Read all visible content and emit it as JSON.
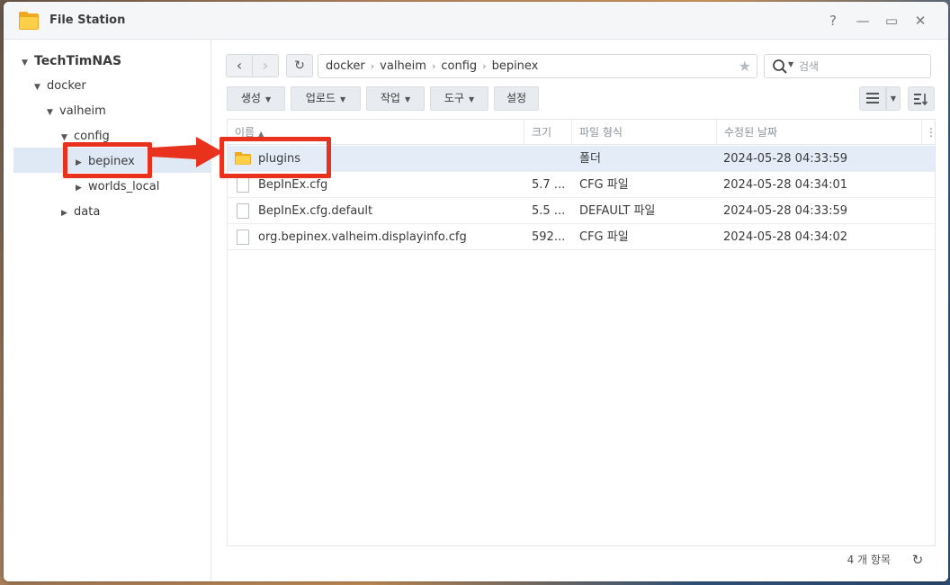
{
  "window": {
    "title": "File Station",
    "controls": {
      "help": "?",
      "minimize": "—",
      "maximize": "▭",
      "close": "✕"
    }
  },
  "sidebar": {
    "root": "TechTimNAS",
    "items": [
      {
        "label": "docker"
      },
      {
        "label": "valheim"
      },
      {
        "label": "config"
      },
      {
        "label": "bepinex"
      },
      {
        "label": "worlds_local"
      },
      {
        "label": "data"
      }
    ]
  },
  "toolbar": {
    "path": [
      "docker",
      "valheim",
      "config",
      "bepinex"
    ],
    "search_placeholder": "검색",
    "buttons": [
      "생성",
      "업로드",
      "작업",
      "도구",
      "설정"
    ]
  },
  "table": {
    "columns": [
      "이름",
      "크기",
      "파일 형식",
      "수정된 날짜"
    ],
    "rows": [
      {
        "name": "plugins",
        "size": "",
        "type": "폴더",
        "modified": "2024-05-28 04:33:59",
        "kind": "folder"
      },
      {
        "name": "BepInEx.cfg",
        "size": "5.7 ...",
        "type": "CFG 파일",
        "modified": "2024-05-28 04:34:01",
        "kind": "file"
      },
      {
        "name": "BepInEx.cfg.default",
        "size": "5.5 ...",
        "type": "DEFAULT 파일",
        "modified": "2024-05-28 04:33:59",
        "kind": "file"
      },
      {
        "name": "org.bepinex.valheim.displayinfo.cfg",
        "size": "592...",
        "type": "CFG 파일",
        "modified": "2024-05-28 04:34:02",
        "kind": "file"
      }
    ]
  },
  "footer": {
    "count": "4 개 항목"
  },
  "colors": {
    "annotation": "#e8321e",
    "selection": "#e3ecf7",
    "folder": "#f2b632"
  }
}
